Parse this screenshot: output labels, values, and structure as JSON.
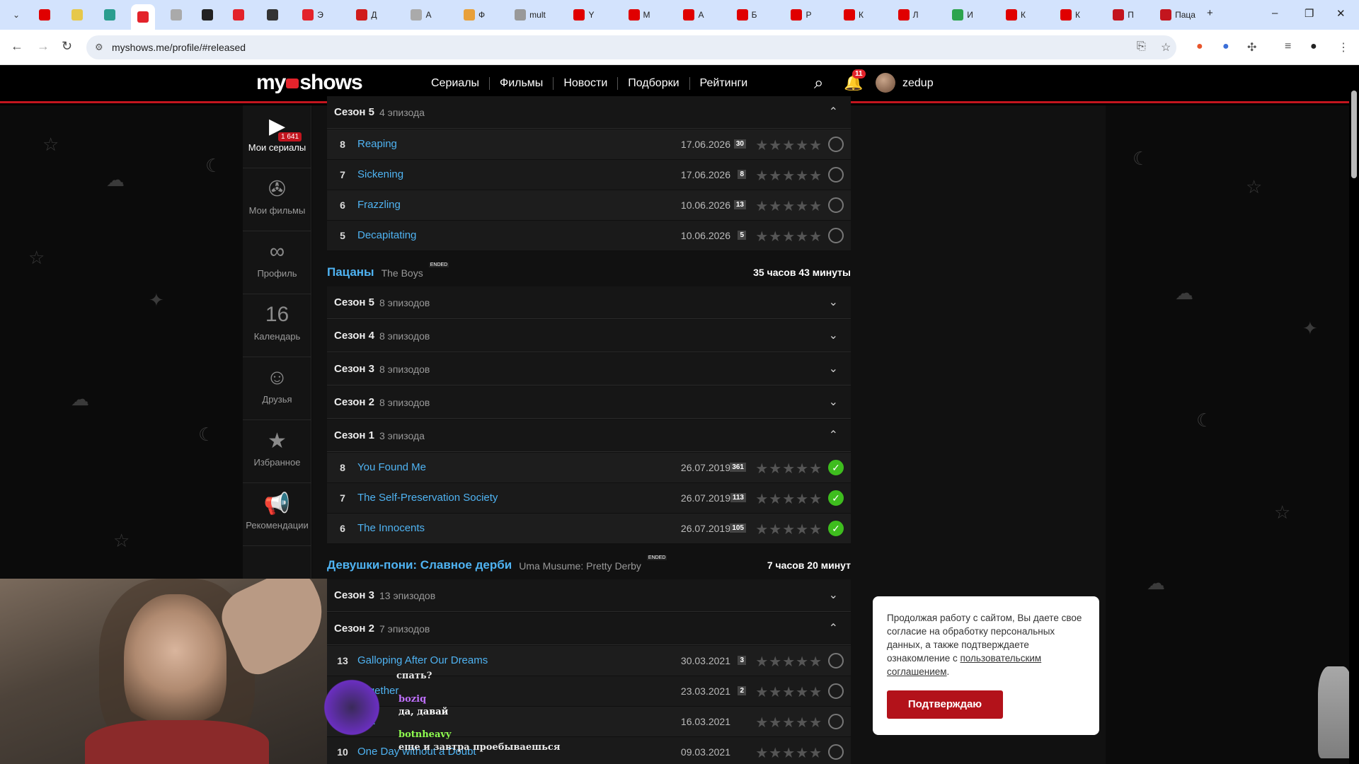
{
  "browser": {
    "tabs": [
      {
        "title": "",
        "color": "#e00000"
      },
      {
        "title": "",
        "color": "#e6c84a"
      },
      {
        "title": "",
        "color": "#2a9d8f"
      },
      {
        "title": "",
        "color": "#e3232b"
      },
      {
        "title": "",
        "color": "#aaaaaa"
      },
      {
        "title": "",
        "color": "#222222"
      },
      {
        "title": "",
        "color": "#e3232b"
      },
      {
        "title": "",
        "color": "#333333"
      },
      {
        "title": "Э",
        "color": "#e3232b"
      },
      {
        "title": "Д",
        "color": "#d01c1c"
      },
      {
        "title": "А",
        "color": "#aaaaaa"
      },
      {
        "title": "Ф",
        "color": "#e8a03a"
      },
      {
        "title": "mult",
        "color": "#999999"
      },
      {
        "title": "Y",
        "color": "#e00000"
      },
      {
        "title": "М",
        "color": "#e00000"
      },
      {
        "title": "А",
        "color": "#e00000"
      },
      {
        "title": "Б",
        "color": "#e00000"
      },
      {
        "title": "Р",
        "color": "#e00000"
      },
      {
        "title": "К",
        "color": "#e00000"
      },
      {
        "title": "Л",
        "color": "#e00000"
      },
      {
        "title": "И",
        "color": "#2da44e"
      },
      {
        "title": "К",
        "color": "#e00000"
      },
      {
        "title": "К",
        "color": "#e00000"
      },
      {
        "title": "П",
        "color": "#c3151e"
      },
      {
        "title": "Паца",
        "color": "#c3151e"
      }
    ],
    "url": "myshows.me/profile/#released",
    "new_tab": "+",
    "minimize": "–",
    "restore": "❐",
    "close": "✕"
  },
  "header": {
    "logo_left": "my",
    "logo_right": "shows",
    "nav": [
      "Сериалы",
      "Фильмы",
      "Новости",
      "Подборки",
      "Рейтинги"
    ],
    "notifications": "11",
    "username": "zedup"
  },
  "sidebar": {
    "items": [
      {
        "label": "Мои сериалы",
        "icon": "tv-play-icon",
        "glyph": "▶",
        "badge": "1 641",
        "active": true
      },
      {
        "label": "Мои фильмы",
        "icon": "film-reel-icon",
        "glyph": "✇",
        "active": false
      },
      {
        "label": "Профиль",
        "icon": "glasses-icon",
        "glyph": "∞",
        "active": false
      },
      {
        "label": "Календарь",
        "icon": "calendar-icon",
        "glyph": "16",
        "active": false
      },
      {
        "label": "Друзья",
        "icon": "masks-icon",
        "glyph": "☺",
        "active": false
      },
      {
        "label": "Избранное",
        "icon": "star-icon",
        "glyph": "★",
        "active": false
      },
      {
        "label": "Рекомендации",
        "icon": "megaphone-icon",
        "glyph": "📢",
        "active": false
      }
    ]
  },
  "content": {
    "block1": {
      "season": {
        "name": "Сезон 5",
        "count": "4 эпизода",
        "expanded": true
      },
      "episodes": [
        {
          "num": "8",
          "title": "Reaping",
          "date": "17.06.2026",
          "comments": "30",
          "watched": false
        },
        {
          "num": "7",
          "title": "Sickening",
          "date": "17.06.2026",
          "comments": "8",
          "watched": false
        },
        {
          "num": "6",
          "title": "Frazzling",
          "date": "10.06.2026",
          "comments": "13",
          "watched": false
        },
        {
          "num": "5",
          "title": "Decapitating",
          "date": "10.06.2026",
          "comments": "5",
          "watched": false
        }
      ]
    },
    "show2": {
      "title_ru": "Пацаны",
      "title_orig": "The Boys",
      "ended": "ENDED",
      "duration": "35 часов 43 минуты",
      "seasons": [
        {
          "name": "Сезон 5",
          "count": "8 эпизодов",
          "expanded": false
        },
        {
          "name": "Сезон 4",
          "count": "8 эпизодов",
          "expanded": false
        },
        {
          "name": "Сезон 3",
          "count": "8 эпизодов",
          "expanded": false
        },
        {
          "name": "Сезон 2",
          "count": "8 эпизодов",
          "expanded": false
        },
        {
          "name": "Сезон 1",
          "count": "3 эпизода",
          "expanded": true
        }
      ],
      "episodes": [
        {
          "num": "8",
          "title": "You Found Me",
          "date": "26.07.2019",
          "comments": "361",
          "watched": true
        },
        {
          "num": "7",
          "title": "The Self-Preservation Society",
          "date": "26.07.2019",
          "comments": "113",
          "watched": true
        },
        {
          "num": "6",
          "title": "The Innocents",
          "date": "26.07.2019",
          "comments": "105",
          "watched": true
        }
      ]
    },
    "show3": {
      "title_ru": "Девушки-пони: Славное дерби",
      "title_orig": "Uma Musume: Pretty Derby",
      "ended": "ENDED",
      "duration": "7 часов 20 минут",
      "seasons": [
        {
          "name": "Сезон 3",
          "count": "13 эпизодов",
          "expanded": false
        },
        {
          "name": "Сезон 2",
          "count": "7 эпизодов",
          "expanded": true
        }
      ],
      "episodes": [
        {
          "num": "13",
          "title": "Galloping After Our Dreams",
          "date": "30.03.2021",
          "comments": "3",
          "watched": false
        },
        {
          "num": "12",
          "title": "Together",
          "date": "23.03.2021",
          "comments": "2",
          "watched": false
        },
        {
          "num": "11",
          "title": "Kl...",
          "date": "16.03.2021",
          "comments": "",
          "watched": false
        },
        {
          "num": "10",
          "title": "One Day without a Doubt",
          "date": "09.03.2021",
          "comments": "",
          "watched": false
        }
      ]
    },
    "stars": "★★★★★",
    "chev_up": "⌃",
    "chev_down": "⌄",
    "check": "✓"
  },
  "cookie": {
    "text": "Продолжая работу с сайтом, Вы даете свое согласие на обработку персональных данных, а также подтверждаете ознакомление с ",
    "link": "пользовательским соглашением",
    "text_end": ".",
    "button": "Подтверждаю"
  },
  "overlay_chat": [
    {
      "text": "спать?",
      "color": "#e8e8e8"
    },
    {
      "text": "boziq",
      "color": "#c070ff"
    },
    {
      "text": "да, давай",
      "color": "#ffffff"
    },
    {
      "text": "botnheavy",
      "color": "#8fff4f"
    },
    {
      "text": "еще и завтра проебываешься",
      "color": "#e8e8e8"
    }
  ]
}
